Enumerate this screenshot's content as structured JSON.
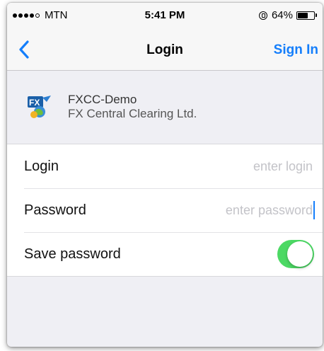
{
  "status_bar": {
    "carrier": "MTN",
    "signal_bars_filled": 4,
    "signal_bars_total": 5,
    "time": "5:41 PM",
    "battery_percent": "64%",
    "battery_level": 0.64,
    "icons": [
      "signal-dots-icon",
      "orientation-lock-icon",
      "battery-icon"
    ]
  },
  "nav": {
    "back_icon": "chevron-left-icon",
    "title": "Login",
    "action_label": "Sign In",
    "accent_color": "#147efb"
  },
  "server": {
    "logo_icon": "fxcc-logo-icon",
    "name": "FXCC-Demo",
    "company": "FX Central Clearing Ltd."
  },
  "form": {
    "login": {
      "label": "Login",
      "value": "",
      "placeholder": "enter login"
    },
    "password": {
      "label": "Password",
      "value": "",
      "placeholder": "enter password"
    },
    "save_password": {
      "label": "Save password",
      "enabled": true,
      "toggle_color": "#4cd964"
    }
  }
}
